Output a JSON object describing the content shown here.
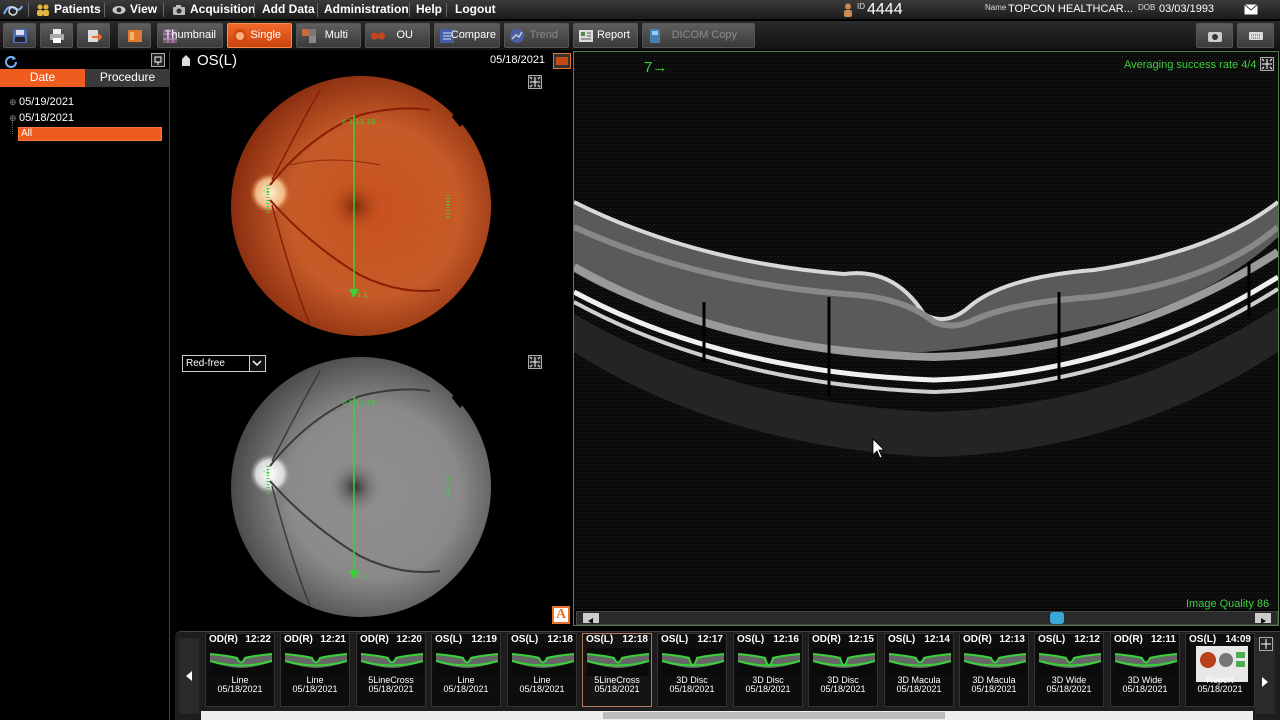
{
  "menu": {
    "patients": "Patients",
    "view": "View",
    "acquisition": "Acquisition",
    "add_data": "Add Data",
    "administration": "Administration",
    "help": "Help",
    "logout": "Logout"
  },
  "patient": {
    "id_label": "ID",
    "id": "4444",
    "name_label": "Name",
    "name": "TOPCON HEALTHCAR...",
    "dob_label": "DOB",
    "dob": "03/03/1993"
  },
  "toolbar": {
    "thumbnail": "Thumbnail",
    "single": "Single",
    "multi": "Multi",
    "ou": "OU",
    "compare": "Compare",
    "trend": "Trend",
    "report": "Report",
    "dicom_copy": "DICOM Copy"
  },
  "left_panel": {
    "tab_date": "Date",
    "tab_procedure": "Procedure",
    "dates": [
      "05/19/2021",
      "05/18/2021"
    ],
    "all_label": "All"
  },
  "center": {
    "eye_label": "OS(L)",
    "date": "05/18/2021",
    "filter_select": "Red-free",
    "text_a_button": "A"
  },
  "oct": {
    "frame_number": "7→",
    "averaging": "Averaging success rate 4/4",
    "image_quality": "Image Quality 86",
    "scroll_position": 0.7
  },
  "thumbnails": [
    {
      "eye": "OD(R)",
      "time": "12:22",
      "type": "Line",
      "date": "05/18/2021"
    },
    {
      "eye": "OD(R)",
      "time": "12:21",
      "type": "Line",
      "date": "05/18/2021"
    },
    {
      "eye": "OD(R)",
      "time": "12:20",
      "type": "5LineCross",
      "date": "05/18/2021"
    },
    {
      "eye": "OS(L)",
      "time": "12:19",
      "type": "Line",
      "date": "05/18/2021"
    },
    {
      "eye": "OS(L)",
      "time": "12:18",
      "type": "Line",
      "date": "05/18/2021"
    },
    {
      "eye": "OS(L)",
      "time": "12:18",
      "type": "5LineCross",
      "date": "05/18/2021"
    },
    {
      "eye": "OS(L)",
      "time": "12:17",
      "type": "3D Disc",
      "date": "05/18/2021"
    },
    {
      "eye": "OS(L)",
      "time": "12:16",
      "type": "3D Disc",
      "date": "05/18/2021"
    },
    {
      "eye": "OD(R)",
      "time": "12:15",
      "type": "3D Disc",
      "date": "05/18/2021"
    },
    {
      "eye": "OS(L)",
      "time": "12:14",
      "type": "3D Macula",
      "date": "05/18/2021"
    },
    {
      "eye": "OD(R)",
      "time": "12:13",
      "type": "3D Macula",
      "date": "05/18/2021"
    },
    {
      "eye": "OS(L)",
      "time": "12:12",
      "type": "3D Wide",
      "date": "05/18/2021"
    },
    {
      "eye": "OD(R)",
      "time": "12:11",
      "type": "3D Wide",
      "date": "05/18/2021"
    },
    {
      "eye": "OS(L)",
      "time": "14:09",
      "type": "Report",
      "date": "05/18/2021"
    }
  ],
  "colors": {
    "accent": "#ee5d1f",
    "overlay_green": "#39d239"
  }
}
